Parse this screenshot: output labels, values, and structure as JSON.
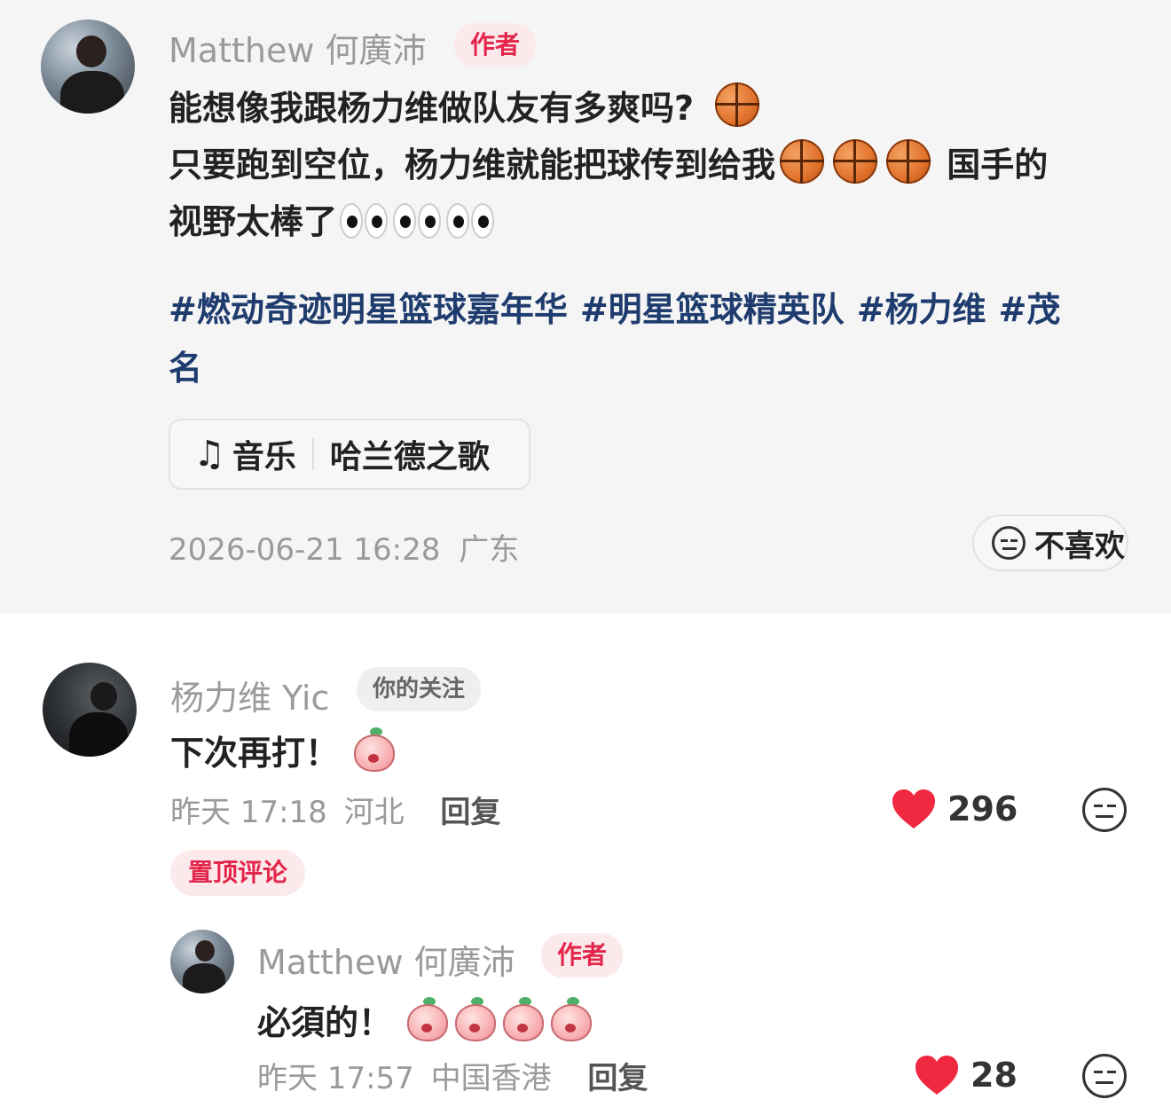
{
  "post": {
    "author": "Matthew 何廣沛",
    "author_badge": "作者",
    "lines": [
      "能想像我跟杨力维做队友有多爽吗?",
      "只要跑到空位，杨力维就能把球传到给我",
      "国手的",
      "视野太棒了"
    ],
    "tags": [
      "#燃动奇迹明星篮球嘉年华",
      "#明星篮球精英队",
      "#杨力维",
      "#茂"
    ],
    "tag_wrap": "名",
    "music_label": "音乐",
    "music_title": "哈兰德之歌",
    "timestamp": "2026-06-21 16:28",
    "location": "广东",
    "dislike_label": "不喜欢",
    "icons": [
      "basketball-icon",
      "eyes-icon",
      "music-note-icon",
      "meh-face-icon"
    ]
  },
  "comments": [
    {
      "user": "杨力维 Yic",
      "badge": "你的关注",
      "text": "下次再打！",
      "time": "昨天 17:18",
      "location": "河北",
      "reply_label": "回复",
      "likes": "296",
      "pin_label": "置顶评论"
    }
  ],
  "reply": {
    "user": "Matthew 何廣沛",
    "badge": "作者",
    "text": "必須的！",
    "time": "昨天 17:57",
    "location": "中国香港",
    "reply_label": "回复",
    "likes": "28"
  },
  "colors": {
    "author_badge_bg": "#fbe9ec",
    "author_badge_text": "#e3264a",
    "tag_color": "#1f3c6e",
    "heart": "#f02941"
  }
}
